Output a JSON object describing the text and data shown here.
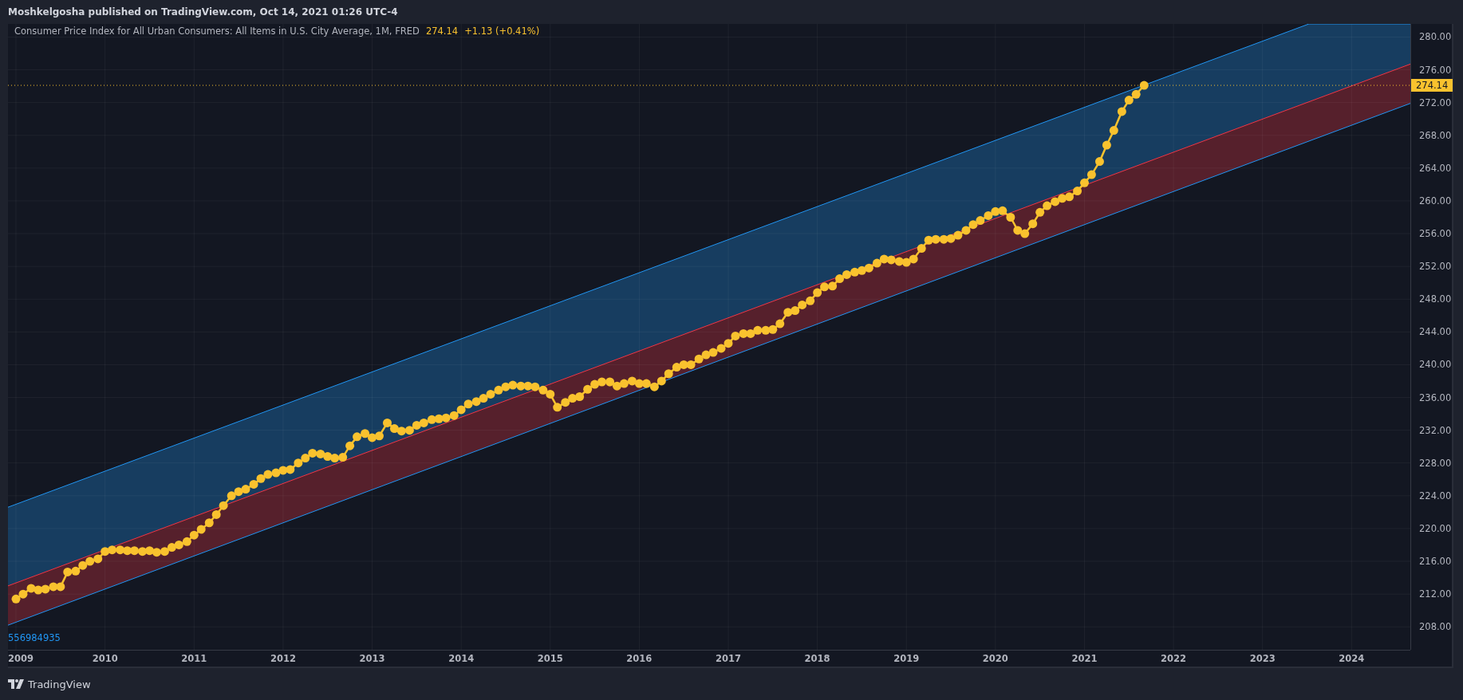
{
  "header": {
    "text": "Moshkelgosha published on TradingView.com, Oct 14, 2021 01:26 UTC-4"
  },
  "legend": {
    "title": "Consumer Price Index for All Urban Consumers: All Items in U.S. City Average, 1M, FRED",
    "value": "274.14",
    "change": "+1.13 (+0.41%)"
  },
  "chart": {
    "last_price_label": "274.14",
    "channel_label": "556984935",
    "chart_data": {
      "type": "line",
      "xlim": [
        2008.91,
        2024.66
      ],
      "ylim": [
        205.2,
        281.6
      ],
      "xticks": [
        {
          "value": 2009,
          "label": "2009"
        },
        {
          "value": 2010,
          "label": "2010"
        },
        {
          "value": 2011,
          "label": "2011"
        },
        {
          "value": 2012,
          "label": "2012"
        },
        {
          "value": 2013,
          "label": "2013"
        },
        {
          "value": 2014,
          "label": "2014"
        },
        {
          "value": 2015,
          "label": "2015"
        },
        {
          "value": 2016,
          "label": "2016"
        },
        {
          "value": 2017,
          "label": "2017"
        },
        {
          "value": 2018,
          "label": "2018"
        },
        {
          "value": 2019,
          "label": "2019"
        },
        {
          "value": 2020,
          "label": "2020"
        },
        {
          "value": 2021,
          "label": "2021"
        },
        {
          "value": 2022,
          "label": "2022"
        },
        {
          "value": 2023,
          "label": "2023"
        },
        {
          "value": 2024,
          "label": "2024"
        }
      ],
      "yticks": [
        {
          "value": 208,
          "label": "208.00"
        },
        {
          "value": 212,
          "label": "212.00"
        },
        {
          "value": 216,
          "label": "216.00"
        },
        {
          "value": 220,
          "label": "220.00"
        },
        {
          "value": 224,
          "label": "224.00"
        },
        {
          "value": 228,
          "label": "228.00"
        },
        {
          "value": 232,
          "label": "232.00"
        },
        {
          "value": 236,
          "label": "236.00"
        },
        {
          "value": 240,
          "label": "240.00"
        },
        {
          "value": 244,
          "label": "244.00"
        },
        {
          "value": 248,
          "label": "248.00"
        },
        {
          "value": 252,
          "label": "252.00"
        },
        {
          "value": 256,
          "label": "256.00"
        },
        {
          "value": 260,
          "label": "260.00"
        },
        {
          "value": 264,
          "label": "264.00"
        },
        {
          "value": 268,
          "label": "268.00"
        },
        {
          "value": 272,
          "label": "272.00"
        },
        {
          "value": 276,
          "label": "276.00"
        },
        {
          "value": 280,
          "label": "280.00"
        }
      ],
      "x": [
        2009,
        2009.08,
        2009.17,
        2009.25,
        2009.33,
        2009.42,
        2009.5,
        2009.58,
        2009.67,
        2009.75,
        2009.83,
        2009.92,
        2010,
        2010.08,
        2010.17,
        2010.25,
        2010.33,
        2010.42,
        2010.5,
        2010.58,
        2010.67,
        2010.75,
        2010.83,
        2010.92,
        2011,
        2011.08,
        2011.17,
        2011.25,
        2011.33,
        2011.42,
        2011.5,
        2011.58,
        2011.67,
        2011.75,
        2011.83,
        2011.92,
        2012,
        2012.08,
        2012.17,
        2012.25,
        2012.33,
        2012.42,
        2012.5,
        2012.58,
        2012.67,
        2012.75,
        2012.83,
        2012.92,
        2013,
        2013.08,
        2013.17,
        2013.25,
        2013.33,
        2013.42,
        2013.5,
        2013.58,
        2013.67,
        2013.75,
        2013.83,
        2013.92,
        2014,
        2014.08,
        2014.17,
        2014.25,
        2014.33,
        2014.42,
        2014.5,
        2014.58,
        2014.67,
        2014.75,
        2014.83,
        2014.92,
        2015,
        2015.08,
        2015.17,
        2015.25,
        2015.33,
        2015.42,
        2015.5,
        2015.58,
        2015.67,
        2015.75,
        2015.83,
        2015.92,
        2016,
        2016.08,
        2016.17,
        2016.25,
        2016.33,
        2016.42,
        2016.5,
        2016.58,
        2016.67,
        2016.75,
        2016.83,
        2016.92,
        2017,
        2017.08,
        2017.17,
        2017.25,
        2017.33,
        2017.42,
        2017.5,
        2017.58,
        2017.67,
        2017.75,
        2017.83,
        2017.92,
        2018,
        2018.08,
        2018.17,
        2018.25,
        2018.33,
        2018.42,
        2018.5,
        2018.58,
        2018.67,
        2018.75,
        2018.83,
        2018.92,
        2019,
        2019.08,
        2019.17,
        2019.25,
        2019.33,
        2019.42,
        2019.5,
        2019.58,
        2019.67,
        2019.75,
        2019.83,
        2019.92,
        2020,
        2020.08,
        2020.17,
        2020.25,
        2020.33,
        2020.42,
        2020.5,
        2020.58,
        2020.67,
        2020.75,
        2020.83,
        2020.92,
        2021,
        2021.08,
        2021.17,
        2021.25,
        2021.33,
        2021.42,
        2021.5,
        2021.58,
        2021.67
      ],
      "grid": true,
      "series": [
        {
          "color": "#f9c22e",
          "marker": "circle",
          "values": [
            211.4,
            212.0,
            212.7,
            212.5,
            212.6,
            212.9,
            212.9,
            214.7,
            214.8,
            215.5,
            216.0,
            216.3,
            217.2,
            217.4,
            217.4,
            217.3,
            217.3,
            217.2,
            217.3,
            217.1,
            217.2,
            217.7,
            218.0,
            218.4,
            219.2,
            219.9,
            220.7,
            221.7,
            222.8,
            224.0,
            224.5,
            224.8,
            225.4,
            226.1,
            226.6,
            226.8,
            227.1,
            227.2,
            228.0,
            228.6,
            229.2,
            229.1,
            228.8,
            228.6,
            228.7,
            230.1,
            231.2,
            231.6,
            231.1,
            231.3,
            232.9,
            232.2,
            231.9,
            232.0,
            232.6,
            232.9,
            233.3,
            233.4,
            233.5,
            233.8,
            234.5,
            235.2,
            235.5,
            235.9,
            236.4,
            236.9,
            237.3,
            237.5,
            237.4,
            237.4,
            237.3,
            236.9,
            236.4,
            234.8,
            235.4,
            235.9,
            236.1,
            237.0,
            237.6,
            237.9,
            237.9,
            237.4,
            237.7,
            238.0,
            237.7,
            237.7,
            237.3,
            238.0,
            238.9,
            239.7,
            240.0,
            240.0,
            240.7,
            241.2,
            241.5,
            242.0,
            242.6,
            243.5,
            243.8,
            243.8,
            244.2,
            244.2,
            244.3,
            245.0,
            246.4,
            246.6,
            247.3,
            247.8,
            248.8,
            249.5,
            249.6,
            250.5,
            251.0,
            251.3,
            251.5,
            251.8,
            252.4,
            252.9,
            252.8,
            252.6,
            252.5,
            252.9,
            254.2,
            255.2,
            255.3,
            255.3,
            255.4,
            255.8,
            256.4,
            257.1,
            257.6,
            258.2,
            258.7,
            258.8,
            258.0,
            256.4,
            256.0,
            257.2,
            258.6,
            259.4,
            259.9,
            260.3,
            260.5,
            261.2,
            262.2,
            263.2,
            264.8,
            266.8,
            268.6,
            270.9,
            272.3,
            273.0,
            274.1
          ]
        }
      ]
    }
  },
  "footer": {
    "brand": "TradingView"
  }
}
